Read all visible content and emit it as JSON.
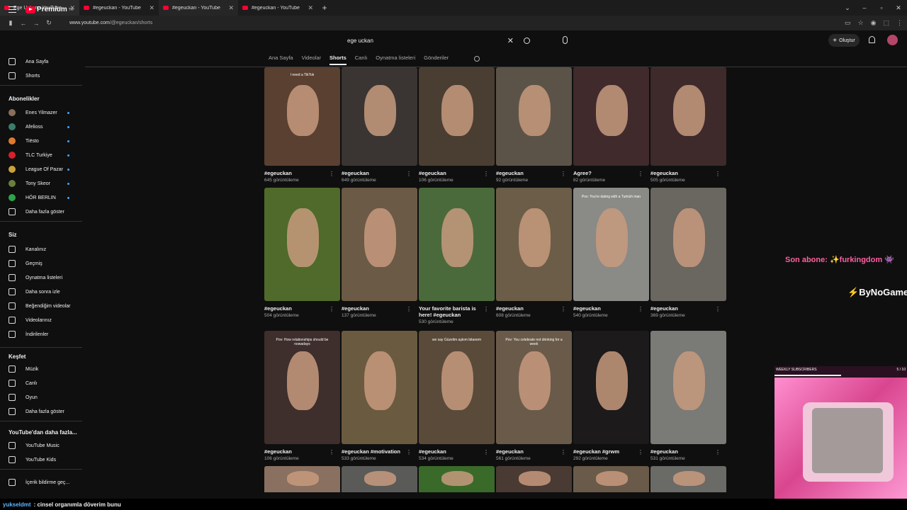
{
  "browser": {
    "tabs": [
      {
        "title": "Ege Uçkan - YouTube"
      },
      {
        "title": "#egeuckan - YouTube"
      },
      {
        "title": "#egeuckan - YouTube"
      },
      {
        "title": "#egeuckan - YouTube"
      }
    ],
    "url_host": "www.youtube.com",
    "url_path": "/@egeuckan/shorts"
  },
  "masthead": {
    "logo_text": "Premium",
    "logo_sup": "TR",
    "search_value": "ege uckan",
    "create_label": "Oluştur"
  },
  "sidebar": {
    "top": [
      {
        "label": "Ana Sayfa",
        "icon": "home-icon"
      },
      {
        "label": "Shorts",
        "icon": "shorts-icon"
      }
    ],
    "subs_heading": "Abonelikler",
    "subs": [
      {
        "label": "Enes Yilmazer",
        "color": "#8a6f5a"
      },
      {
        "label": "Afelioss",
        "color": "#3c7d6a"
      },
      {
        "label": "Tiësto",
        "color": "#e07a2f"
      },
      {
        "label": "TLC Turkiye",
        "color": "#d8202a"
      },
      {
        "label": "League Of Pazar",
        "color": "#c9a23a"
      },
      {
        "label": "Tony Skeor",
        "color": "#6a7f3f"
      },
      {
        "label": "HÖR BERLIN",
        "color": "#2fa34a"
      }
    ],
    "subs_more": "Daha fazla göster",
    "you_heading": "Siz",
    "you": [
      {
        "label": "Kanalınız",
        "icon": "channel-icon"
      },
      {
        "label": "Geçmiş",
        "icon": "history-icon"
      },
      {
        "label": "Oynatma listeleri",
        "icon": "playlists-icon"
      },
      {
        "label": "Daha sonra izle",
        "icon": "watch-later-icon"
      },
      {
        "label": "Beğendiğim videolar",
        "icon": "liked-icon"
      },
      {
        "label": "Videolarınız",
        "icon": "your-videos-icon"
      },
      {
        "label": "İndirilenler",
        "icon": "downloads-icon"
      }
    ],
    "explore_heading": "Keşfet",
    "explore": [
      {
        "label": "Müzik",
        "icon": "music-icon"
      },
      {
        "label": "Canlı",
        "icon": "live-icon"
      },
      {
        "label": "Oyun",
        "icon": "gaming-icon"
      }
    ],
    "explore_more": "Daha fazla göster",
    "more_heading": "YouTube'dan daha fazla...",
    "more": [
      {
        "label": "YouTube Music",
        "icon": "youtube-music-icon"
      },
      {
        "label": "YouTube Kids",
        "icon": "youtube-kids-icon"
      }
    ],
    "report": "İçerik bildirme geç..."
  },
  "channel_tabs": [
    "Ana Sayfa",
    "Videolar",
    "Shorts",
    "Canlı",
    "Oynatma listeleri",
    "Gönderiler"
  ],
  "active_tab": "Shorts",
  "shorts": [
    {
      "title": "#egeuckan",
      "views": "645 görüntüleme",
      "bg": "#5a4030",
      "caption": "I need a TikTok"
    },
    {
      "title": "#egeuckan",
      "views": "649 görüntüleme",
      "bg": "#3a3532",
      "caption": ""
    },
    {
      "title": "#egeuckan",
      "views": "106 görüntüleme",
      "bg": "#4a3e32",
      "caption": ""
    },
    {
      "title": "#egeuckan",
      "views": "92 görüntüleme",
      "bg": "#5b5348",
      "caption": ""
    },
    {
      "title": "Agree?",
      "views": "82 görüntüleme",
      "bg": "#402a2c",
      "caption": ""
    },
    {
      "title": "#egeuckan",
      "views": "505 görüntüleme",
      "bg": "#3e2a2a",
      "caption": ""
    },
    {
      "title": "#egeuckan",
      "views": "504 görüntüleme",
      "bg": "#4f6a2a",
      "caption": ""
    },
    {
      "title": "#egeuckan",
      "views": "137 görüntüleme",
      "bg": "#6b5a45",
      "caption": ""
    },
    {
      "title": "Your favorite barista is here! #egeuckan",
      "views": "530 görüntüleme",
      "bg": "#4b6a3c",
      "caption": ""
    },
    {
      "title": "#egeuckan",
      "views": "608 görüntüleme",
      "bg": "#6b5d48",
      "caption": ""
    },
    {
      "title": "#egeuckan",
      "views": "540 görüntüleme",
      "bg": "#8a8a86",
      "caption": "Pov: You're dating with a Turkish man"
    },
    {
      "title": "#egeuckan",
      "views": "369 görüntüleme",
      "bg": "#6a6660",
      "caption": ""
    },
    {
      "title": "#egeuckan",
      "views": "106 görüntüleme",
      "bg": "#3e2e2c",
      "caption": "Pov: How relationships should be nowadays"
    },
    {
      "title": "#egeuckan #motivation",
      "views": "533 görüntüleme",
      "bg": "#6a5a40",
      "caption": ""
    },
    {
      "title": "#egeuckan",
      "views": "534 görüntüleme",
      "bg": "#5a4a3a",
      "caption": "we say Güzelim aşkım bitanem"
    },
    {
      "title": "#egeuckan",
      "views": "561 görüntüleme",
      "bg": "#6a5a4a",
      "caption": "Pov: You celebrate not drinking for a week"
    },
    {
      "title": "#egeuckan #grwm",
      "views": "292 görüntüleme",
      "bg": "#1c1a1a",
      "caption": ""
    },
    {
      "title": "#egeuckan",
      "views": "531 görüntüleme",
      "bg": "#7a7a76",
      "caption": ""
    },
    {
      "title": "",
      "views": "",
      "bg": "#8a7060",
      "caption": ""
    },
    {
      "title": "",
      "views": "",
      "bg": "#5a5a58",
      "caption": ""
    },
    {
      "title": "",
      "views": "",
      "bg": "#3a6a2a",
      "caption": ""
    },
    {
      "title": "",
      "views": "",
      "bg": "#4a3a34",
      "caption": ""
    },
    {
      "title": "",
      "views": "",
      "bg": "#6a5a4a",
      "caption": ""
    },
    {
      "title": "",
      "views": "",
      "bg": "#6a6a66",
      "caption": ""
    }
  ],
  "overlay": {
    "son_abone_label": "Son abone:",
    "son_abone_name": "furkingdom",
    "brand": "ByNoGame",
    "weekly_title": "WEEKLY SUBSCRIBERS",
    "weekly_count": "5 / 10",
    "weekly_progress": 0.5
  },
  "chat": {
    "user": "yukseldmt",
    "message": ": cinsel organımla döverim bunu"
  }
}
